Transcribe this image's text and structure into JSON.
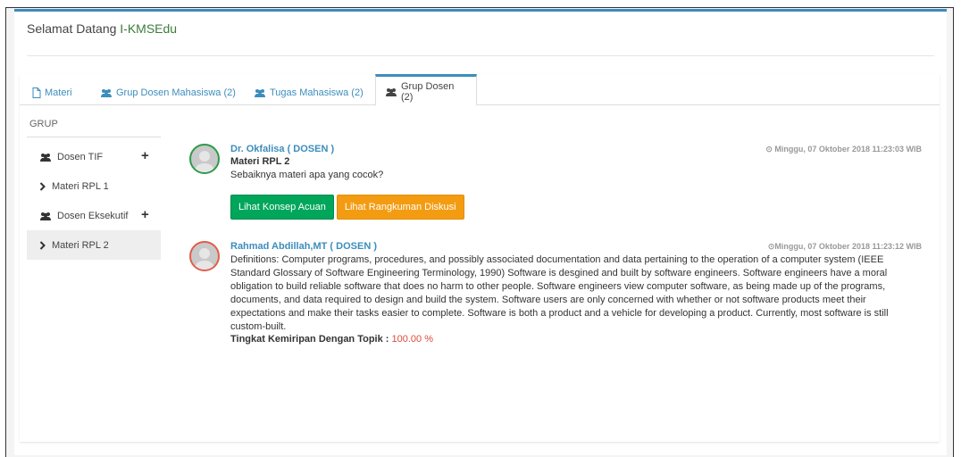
{
  "header": {
    "welcome_prefix": "Selamat Datang ",
    "brand": "I-KMSEdu"
  },
  "tabs": [
    {
      "label": "Materi",
      "icon": "file-icon"
    },
    {
      "label": "Grup Dosen Mahasiswa (2)",
      "icon": "users-icon"
    },
    {
      "label": "Tugas Mahasiswa (2)",
      "icon": "users-icon"
    },
    {
      "label": "Grup Dosen (2)",
      "icon": "users-icon",
      "active": true
    }
  ],
  "sidebar": {
    "title": "GRUP",
    "items": [
      {
        "label": "Dosen TIF",
        "icon": "users-icon",
        "add": "+"
      },
      {
        "label": "Materi RPL 1",
        "icon": "chevron-right-icon"
      },
      {
        "label": "Dosen Eksekutif",
        "icon": "users-icon",
        "add": "+"
      },
      {
        "label": "Materi RPL 2",
        "icon": "chevron-right-icon",
        "active": true
      }
    ]
  },
  "posts": [
    {
      "author": "Dr. Okfalisa ( DOSEN )",
      "timestamp": "⊙ Minggu, 07 Oktober 2018 11:23:03 WIB",
      "subject": "Materi RPL 2",
      "message": "Sebaiknya materi apa yang cocok?",
      "buttons": {
        "concept": "Lihat Konsep Acuan",
        "summary": "Lihat Rangkuman Diskusi"
      }
    },
    {
      "author": "Rahmad Abdillah,MT ( DOSEN )",
      "timestamp": "⊙Minggu, 07 Oktober 2018 11:23:12 WIB",
      "message": "Definitions: Computer programs, procedures, and possibly associated documentation and data pertaining to the operation of a computer system (IEEE Standard Glossary of Software Engineering Terminology, 1990) Software is desgined and built by software engineers. Software engineers have a moral obligation to build reliable software that does no harm to other people. Software engineers view computer software, as being made up of the programs, documents, and data required to design and build the system. Software users are only concerned with whether or not software products meet their expectations and make their tasks easier to complete. Software is both a product and a vehicle for developing a product. Currently, most software is still custom-built.",
      "similarity_label": "Tingkat Kemiripan Dengan Topik : ",
      "similarity_value": "100.00 %"
    }
  ]
}
